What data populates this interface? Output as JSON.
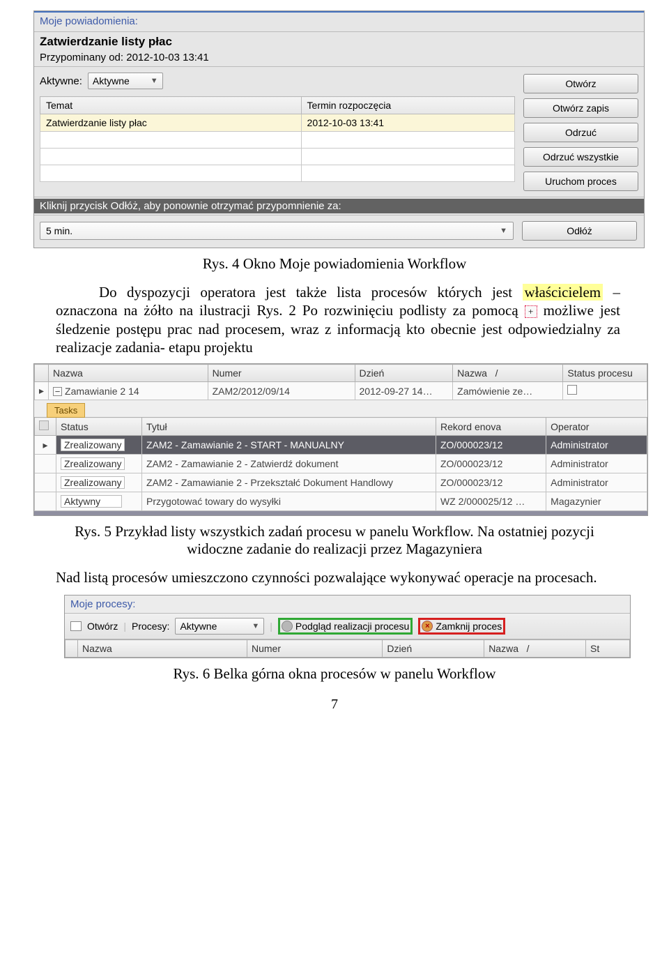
{
  "screenshot1": {
    "header_label": "Moje powiadomienia:",
    "subject": "Zatwierdzanie listy płac",
    "reminded_from": "Przypominany od: 2012-10-03 13:41",
    "active_label": "Aktywne:",
    "active_value": "Aktywne",
    "table": {
      "col1": "Temat",
      "col2": "Termin rozpoczęcia",
      "row1_c1": "Zatwierdzanie listy płac",
      "row1_c2": "2012-10-03 13:41"
    },
    "buttons": {
      "open": "Otwórz",
      "open_record": "Otwórz zapis",
      "reject": "Odrzuć",
      "reject_all": "Odrzuć wszystkie",
      "run_process": "Uruchom proces",
      "postpone": "Odłóż"
    },
    "postpone_label": "Kliknij przycisk Odłóż, aby ponownie otrzymać przypomnienie za:",
    "postpone_value": "5 min."
  },
  "caption1": "Rys. 4 Okno Moje powiadomienia Workflow",
  "para1_a": "Do dyspozycji operatora jest także lista procesów których jest ",
  "para1_yellow": "właścicielem",
  "para1_b": " – oznaczona na żółto na ilustracji Rys. 2 Po rozwinięciu podlisty za pomocą ",
  "plus": "+",
  "para1_c": " możliwe jest  śledzenie postępu prac nad procesem, wraz z informacją kto obecnie jest odpowiedzialny za  realizacje zadania- etapu projektu",
  "screenshot2": {
    "cols": {
      "c1": "Nazwa",
      "c2": "Numer",
      "c3": "Dzień",
      "c4": "Nazwa",
      "c5": "Status procesu"
    },
    "row": {
      "expand": "−",
      "nazwa": "Zamawianie 2 14",
      "numer": "ZAM2/2012/09/14",
      "dzien": "2012-09-27 14…",
      "nazwa2": "Zamówienie ze…"
    },
    "tasks_tab": "Tasks",
    "subcols": {
      "status": "Status",
      "tytul": "Tytuł",
      "rekord": "Rekord enova",
      "operator": "Operator"
    },
    "rows": [
      {
        "status": "Zrealizowany",
        "tytul": "ZAM2 - Zamawianie 2 - START - MANUALNY",
        "rekord": "ZO/000023/12",
        "operator": "Administrator",
        "sel": true
      },
      {
        "status": "Zrealizowany",
        "tytul": "ZAM2 - Zamawianie 2 - Zatwierdź dokument",
        "rekord": "ZO/000023/12",
        "operator": "Administrator"
      },
      {
        "status": "Zrealizowany",
        "tytul": "ZAM2 - Zamawianie 2 - Przekształć Dokument Handlowy",
        "rekord": "ZO/000023/12",
        "operator": "Administrator"
      },
      {
        "status": "Aktywny",
        "tytul": "Przygotować towary do wysyłki",
        "rekord": "WZ 2/000025/12 …",
        "operator": "Magazynier"
      }
    ]
  },
  "caption2a": "Rys. 5 Przykład listy wszystkich zadań procesu w panelu Workflow. Na ostatniej pozycji widoczne zadanie do realizacji przez Magazyniera",
  "para2": "Nad listą procesów umieszczono czynności pozwalające wykonywać operacje na procesach.",
  "screenshot3": {
    "header": "Moje procesy:",
    "open": "Otwórz",
    "procesy_label": "Procesy:",
    "procesy_value": "Aktywne",
    "preview": "Podgląd realizacji procesu",
    "close": "Zamknij proces",
    "cols": {
      "c1": "Nazwa",
      "c2": "Numer",
      "c3": "Dzień",
      "c4": "Nazwa",
      "c5": "St"
    }
  },
  "caption3": "Rys. 6 Belka górna okna procesów w panelu Workflow",
  "page": "7"
}
